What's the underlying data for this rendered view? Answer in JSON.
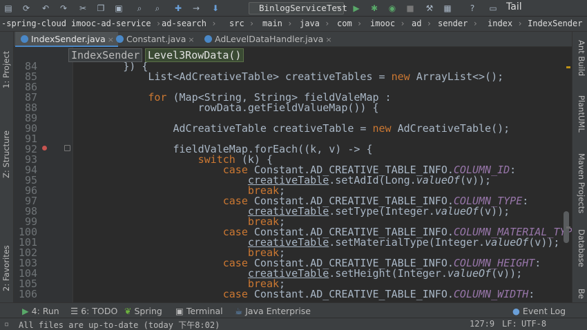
{
  "toolbar": {
    "run_config": "BinlogServiceTest",
    "tail_label": "Tail",
    "icons": [
      "save-icon",
      "sync-icon",
      "undo-icon",
      "redo-icon",
      "cut-icon",
      "copy-icon",
      "paste-icon",
      "find-icon",
      "replace-icon",
      "back-icon",
      "forward-icon",
      "build-icon",
      "run-icon",
      "debug-icon",
      "coverage-icon",
      "stop-icon",
      "project-structure-icon",
      "sdk-icon",
      "help-icon",
      "terminal-icon"
    ]
  },
  "breadcrumb": [
    "-spring-cloud",
    "imooc-ad-service",
    "ad-search",
    "src",
    "main",
    "java",
    "com",
    "imooc",
    "ad",
    "sender",
    "index",
    "IndexSender"
  ],
  "tabs": [
    {
      "label": "IndexSender.java",
      "active": true
    },
    {
      "label": "Constant.java",
      "active": false
    },
    {
      "label": "AdLevelDataHandler.java",
      "active": false
    }
  ],
  "structure_popup": [
    "IndexSender",
    "Level3RowData()"
  ],
  "left_tool_tabs": [
    "1: Project",
    "Z: Structure",
    "2: Favorites"
  ],
  "right_tool_tabs": [
    "Ant Build",
    "PlantUML",
    "Maven Projects",
    "Database",
    "Be"
  ],
  "code": {
    "line_numbers": [
      "84",
      "85",
      "86",
      "87",
      "88",
      "89",
      "90",
      "91",
      "92",
      "93",
      "94",
      "95",
      "96",
      "97",
      "98",
      "99",
      "100",
      "101",
      "102",
      "103",
      "104",
      "105",
      "106"
    ],
    "lines": [
      [
        {
          "t": "        }) {"
        }
      ],
      [
        {
          "t": "            List<AdCreativeTable> creativeTables = "
        },
        {
          "t": "new",
          "c": "kw"
        },
        {
          "t": " ArrayList<>();"
        }
      ],
      [
        {
          "t": ""
        }
      ],
      [
        {
          "t": "            "
        },
        {
          "t": "for",
          "c": "kw"
        },
        {
          "t": " (Map<String, String> fieldValeMap :"
        }
      ],
      [
        {
          "t": "                    rowData.getFieldValueMap()) {"
        }
      ],
      [
        {
          "t": ""
        }
      ],
      [
        {
          "t": "                AdCreativeTable creativeTable = "
        },
        {
          "t": "new",
          "c": "kw"
        },
        {
          "t": " AdCreativeTable();"
        }
      ],
      [
        {
          "t": ""
        }
      ],
      [
        {
          "t": "                fieldValeMap.forEach((k, v) -> {"
        }
      ],
      [
        {
          "t": "                    "
        },
        {
          "t": "switch",
          "c": "kw"
        },
        {
          "t": " (k) {"
        }
      ],
      [
        {
          "t": "                        "
        },
        {
          "t": "case",
          "c": "kw"
        },
        {
          "t": " Constant.AD_CREATIVE_TABLE_INFO."
        },
        {
          "t": "COLUMN_ID",
          "c": "fld"
        },
        {
          "t": ":"
        }
      ],
      [
        {
          "t": "                            "
        },
        {
          "t": "creativeTable",
          "c": "ul"
        },
        {
          "t": ".setAdId(Long."
        },
        {
          "t": "valueOf",
          "c": "ital"
        },
        {
          "t": "(v));"
        }
      ],
      [
        {
          "t": "                            "
        },
        {
          "t": "break",
          "c": "kw"
        },
        {
          "t": ";"
        }
      ],
      [
        {
          "t": "                        "
        },
        {
          "t": "case",
          "c": "kw"
        },
        {
          "t": " Constant.AD_CREATIVE_TABLE_INFO."
        },
        {
          "t": "COLUMN_TYPE",
          "c": "fld"
        },
        {
          "t": ":"
        }
      ],
      [
        {
          "t": "                            "
        },
        {
          "t": "creativeTable",
          "c": "ul"
        },
        {
          "t": ".setType(Integer."
        },
        {
          "t": "valueOf",
          "c": "ital"
        },
        {
          "t": "(v));"
        }
      ],
      [
        {
          "t": "                            "
        },
        {
          "t": "break",
          "c": "kw"
        },
        {
          "t": ";"
        }
      ],
      [
        {
          "t": "                        "
        },
        {
          "t": "case",
          "c": "kw"
        },
        {
          "t": " Constant.AD_CREATIVE_TABLE_INFO."
        },
        {
          "t": "COLUMN_MATERIAL_TYPE",
          "c": "fld"
        },
        {
          "t": ":"
        }
      ],
      [
        {
          "t": "                            "
        },
        {
          "t": "creativeTable",
          "c": "ul"
        },
        {
          "t": ".setMaterialType(Integer."
        },
        {
          "t": "valueOf",
          "c": "ital"
        },
        {
          "t": "(v));"
        }
      ],
      [
        {
          "t": "                            "
        },
        {
          "t": "break",
          "c": "kw"
        },
        {
          "t": ";"
        }
      ],
      [
        {
          "t": "                        "
        },
        {
          "t": "case",
          "c": "kw"
        },
        {
          "t": " Constant.AD_CREATIVE_TABLE_INFO."
        },
        {
          "t": "COLUMN_HEIGHT",
          "c": "fld"
        },
        {
          "t": ":"
        }
      ],
      [
        {
          "t": "                            "
        },
        {
          "t": "creativeTable",
          "c": "ul"
        },
        {
          "t": ".setHeight(Integer."
        },
        {
          "t": "valueOf",
          "c": "ital"
        },
        {
          "t": "(v));"
        }
      ],
      [
        {
          "t": "                            "
        },
        {
          "t": "break",
          "c": "kw"
        },
        {
          "t": ";"
        }
      ],
      [
        {
          "t": "                        "
        },
        {
          "t": "case",
          "c": "kw"
        },
        {
          "t": " Constant.AD_CREATIVE_TABLE_INFO."
        },
        {
          "t": "COLUMN_WIDTH",
          "c": "fld"
        },
        {
          "t": ":"
        }
      ]
    ]
  },
  "bottom_tools": [
    {
      "label": "4: Run",
      "glyph": "▶",
      "icon": "run-icon"
    },
    {
      "label": "6: TODO",
      "glyph": "☰",
      "icon": "todo-icon"
    },
    {
      "label": "Spring",
      "glyph": "❦",
      "icon": "spring-icon"
    },
    {
      "label": "Terminal",
      "glyph": "▣",
      "icon": "terminal-icon"
    },
    {
      "label": "Java Enterprise",
      "glyph": "☕",
      "icon": "java-enterprise-icon"
    },
    {
      "label": "Event Log",
      "glyph": "●",
      "icon": "event-log-icon"
    }
  ],
  "status": {
    "message": "All files are up-to-date (today 下午8:02)",
    "position": "127:9",
    "line_separator": "LF:",
    "encoding": "UTF-8"
  },
  "colors": {
    "editor_bg": "#2b2b2b",
    "chrome_bg": "#3c3f41",
    "keyword": "#cc7832",
    "field": "#9876aa",
    "text": "#a9b7c6",
    "accent": "#4a88c7"
  }
}
